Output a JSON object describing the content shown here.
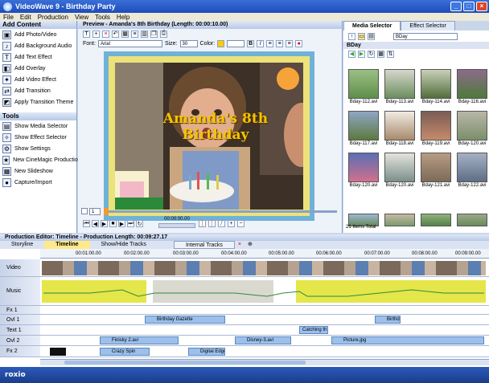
{
  "window": {
    "title": "VideoWave 9 - Birthday Party"
  },
  "menu": [
    "File",
    "Edit",
    "Production",
    "View",
    "Tools",
    "Help"
  ],
  "add_content": {
    "title": "Add Content",
    "items": [
      "Add Photo/Video",
      "Add Background Audio",
      "Add Text Effect",
      "Add Overlay",
      "Add Video Effect",
      "Add Transition",
      "Apply Transition Theme"
    ]
  },
  "tools": {
    "title": "Tools",
    "items": [
      "Show Media Selector",
      "Show Effect Selector",
      "Show Settings",
      "New CineMagic Production",
      "New Slideshow",
      "Capture/Import"
    ]
  },
  "preview": {
    "title": "Preview - Amanda's 8th Birthday (Length: 00:00:10.00)",
    "font_label": "Font:",
    "font_value": "Arial",
    "size_label": "Size:",
    "size_value": "30",
    "color_label": "Color:",
    "overlay_text": "Amanda's 8th Birthday",
    "frame_value": "1",
    "timecode": "00:00:00.00"
  },
  "media": {
    "tab_media": "Media Selector",
    "tab_effect": "Effect Selector",
    "folder_label": "BDay",
    "folder_select": "BDay",
    "thumbs": [
      "Bday-112.avi",
      "Bday-113.avi",
      "Bday-114.avi",
      "Bday-116.avi",
      "Bday-117.avi",
      "Bday-118.avi",
      "Bday-119.avi",
      "Bday-120.avi",
      "Bday-120.avi",
      "Bday-120.avi",
      "Bday-121.avi",
      "Bday-122.avi"
    ],
    "status": "21 Items Total"
  },
  "timeline": {
    "title": "Production Editor: Timeline - Production Length: 00:09:27.17",
    "tabs": [
      "Storyline",
      "Timeline",
      "Show/Hide Tracks"
    ],
    "internal": "Internal Tracks",
    "ruler": [
      "00:01:00.00",
      "00:02:00.00",
      "00:03:00.00",
      "00:04:00.00",
      "00:05:00.00",
      "00:06:00.00",
      "00:07:00.00",
      "00:08:00.00",
      "00:09:00.00"
    ],
    "tracks": [
      "Video",
      "Music",
      "Fx 1",
      "Ovl 1",
      "Text 1",
      "Ovl 2",
      "Fx 2"
    ],
    "clips": {
      "ovl1_a": "Birthday Gazette",
      "ovl1_b": "Birthd...",
      "text1_a": "Catching th...",
      "ovl2_a": "Finisky 2.avi",
      "ovl2_b": "Disney-3.avi",
      "ovl2_c": "Picture.jpg",
      "fx2_a": "Crazy Spin",
      "fx2_b": "Digital Edge"
    }
  },
  "brand": "roxio"
}
